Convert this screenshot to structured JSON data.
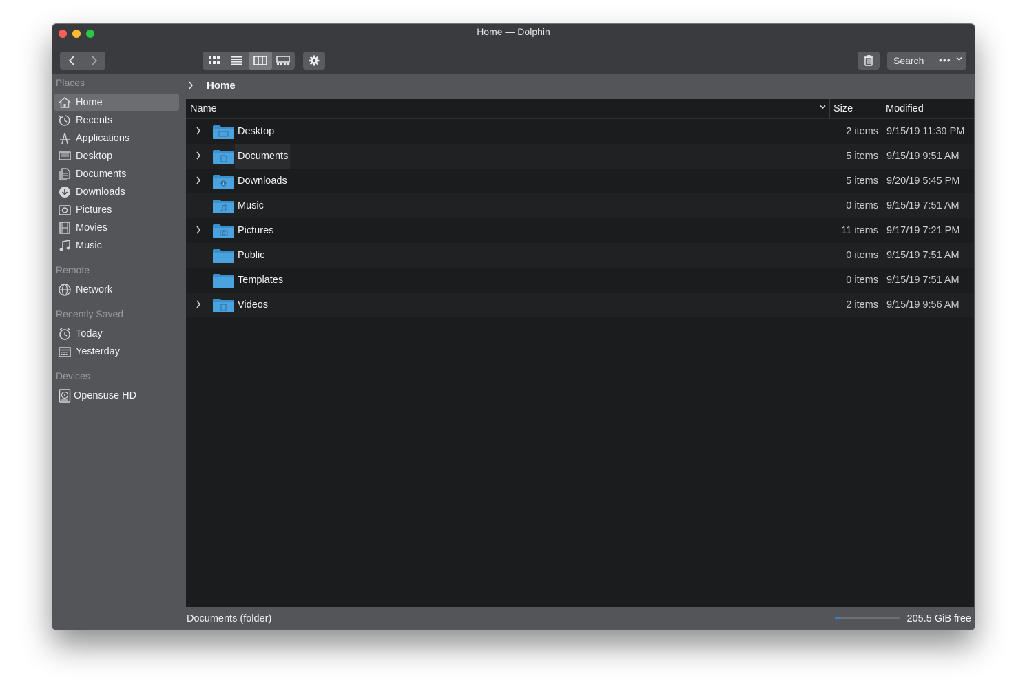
{
  "window": {
    "title": "Home — Dolphin"
  },
  "toolbar": {
    "back_icon": "chevron-left-icon",
    "forward_icon": "chevron-right-icon",
    "view_modes": [
      "icons-view-icon",
      "compact-view-icon",
      "details-view-icon",
      "preview-view-icon"
    ],
    "active_view": "details-view-icon",
    "settings_icon": "gear-icon",
    "trash_icon": "trash-icon",
    "search_label": "Search",
    "more_icon": "ellipsis-icon"
  },
  "sidebar": {
    "places_label": "Places",
    "places": [
      {
        "label": "Home",
        "icon": "home-icon",
        "active": true
      },
      {
        "label": "Recents",
        "icon": "recents-icon"
      },
      {
        "label": "Applications",
        "icon": "applications-icon"
      },
      {
        "label": "Desktop",
        "icon": "desktop-icon"
      },
      {
        "label": "Documents",
        "icon": "documents-icon"
      },
      {
        "label": "Downloads",
        "icon": "downloads-icon"
      },
      {
        "label": "Pictures",
        "icon": "pictures-icon"
      },
      {
        "label": "Movies",
        "icon": "movies-icon"
      },
      {
        "label": "Music",
        "icon": "music-icon"
      }
    ],
    "remote_label": "Remote",
    "remote": [
      {
        "label": "Network",
        "icon": "network-icon"
      }
    ],
    "recent_label": "Recently Saved",
    "recent": [
      {
        "label": "Today",
        "icon": "clock-icon"
      },
      {
        "label": "Yesterday",
        "icon": "calendar-icon"
      }
    ],
    "devices_label": "Devices",
    "devices": [
      {
        "label": "Opensuse HD",
        "icon": "harddisk-icon"
      }
    ]
  },
  "breadcrumb": {
    "current": "Home"
  },
  "columns": {
    "name": "Name",
    "size": "Size",
    "modified": "Modified"
  },
  "files": [
    {
      "name": "Desktop",
      "size": "2 items",
      "modified": "9/15/19 11:39 PM",
      "expandable": true
    },
    {
      "name": "Documents",
      "size": "5 items",
      "modified": "9/15/19 9:51 AM",
      "expandable": true
    },
    {
      "name": "Downloads",
      "size": "5 items",
      "modified": "9/20/19 5:45 PM",
      "expandable": true
    },
    {
      "name": "Music",
      "size": "0 items",
      "modified": "9/15/19 7:51 AM",
      "expandable": false
    },
    {
      "name": "Pictures",
      "size": "11 items",
      "modified": "9/17/19 7:21 PM",
      "expandable": true
    },
    {
      "name": "Public",
      "size": "0 items",
      "modified": "9/15/19 7:51 AM",
      "expandable": false
    },
    {
      "name": "Templates",
      "size": "0 items",
      "modified": "9/15/19 7:51 AM",
      "expandable": false
    },
    {
      "name": "Videos",
      "size": "2 items",
      "modified": "9/15/19 9:56 AM",
      "expandable": true
    }
  ],
  "status": {
    "selection": "Documents (folder)",
    "free_space": "205.5 GiB free",
    "disk_used_fraction": 0.08
  },
  "colors": {
    "accent": "#3d7bd9",
    "folder": "#4aa3df"
  }
}
